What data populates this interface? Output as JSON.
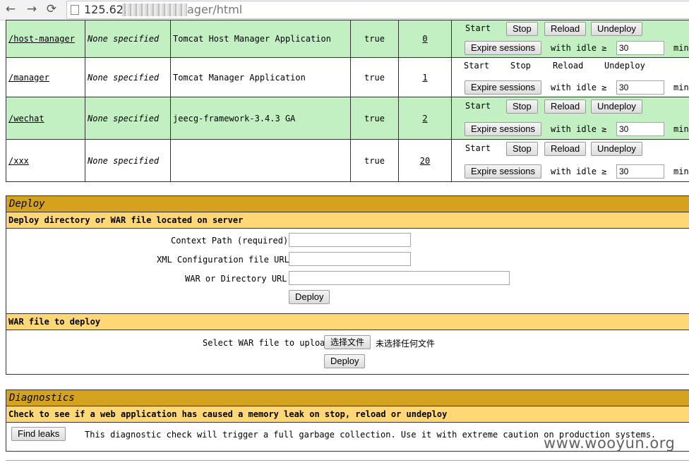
{
  "browser": {
    "url_prefix": "125.62.",
    "url_suffix": "ager/html",
    "back_icon": "arrow-left-icon",
    "forward_icon": "arrow-right-icon",
    "reload_icon": "reload-icon"
  },
  "apps": [
    {
      "path": "/host-manager",
      "version": "None specified",
      "display_name": "Tomcat Host Manager Application",
      "running": "true",
      "sessions": "0",
      "row_style": "green",
      "commands_as_buttons": true
    },
    {
      "path": "/manager",
      "version": "None specified",
      "display_name": "Tomcat Manager Application",
      "running": "true",
      "sessions": "1",
      "row_style": "white",
      "commands_as_buttons": false
    },
    {
      "path": "/wechat",
      "version": "None specified",
      "display_name": "jeecg-framework-3.4.3 GA",
      "running": "true",
      "sessions": "2",
      "row_style": "green",
      "commands_as_buttons": true
    },
    {
      "path": "/xxx",
      "version": "None specified",
      "display_name": "",
      "running": "true",
      "sessions": "20",
      "row_style": "white",
      "commands_as_buttons": true
    }
  ],
  "commands": {
    "start": "Start",
    "stop": "Stop",
    "reload": "Reload",
    "undeploy": "Undeploy",
    "expire_sessions": "Expire sessions",
    "with_idle": "with idle ≥",
    "idle_value": "30",
    "minutes": "minutes"
  },
  "deploy": {
    "title": "Deploy",
    "server_subtitle": "Deploy directory or WAR file located on server",
    "context_path_label": "Context Path (required):",
    "xml_config_label": "XML Configuration file URL:",
    "war_dir_label": "WAR or Directory URL:",
    "deploy_button": "Deploy",
    "war_subtitle": "WAR file to deploy",
    "select_war_label": "Select WAR file to upload",
    "choose_file_button": "选择文件",
    "no_file_chosen": "未选择任何文件",
    "upload_deploy_button": "Deploy"
  },
  "diagnostics": {
    "title": "Diagnostics",
    "subtitle": "Check to see if a web application has caused a memory leak on stop, reload or undeploy",
    "find_leaks_button": "Find leaks",
    "description": "This diagnostic check will trigger a full garbage collection. Use it with extreme caution on production systems."
  },
  "watermark": "www.wooyun.org",
  "colors": {
    "row_green": "#c3f0c3",
    "section_title": "#d4a21c",
    "section_subtitle": "#ffd875"
  }
}
